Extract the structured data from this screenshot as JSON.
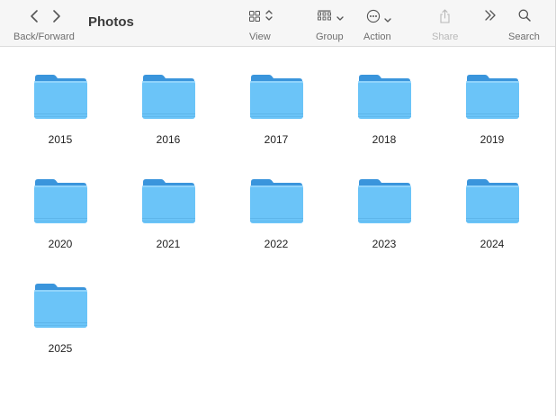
{
  "toolbar": {
    "nav_label": "Back/Forward",
    "title": "Photos",
    "view_label": "View",
    "group_label": "Group",
    "action_label": "Action",
    "share_label": "Share",
    "search_label": "Search"
  },
  "icons": {
    "back": "chevron-left-icon",
    "forward": "chevron-right-icon",
    "view": "icon-grid-icon",
    "group": "group-grid-icon",
    "action": "ellipsis-circle-icon",
    "share": "share-icon",
    "more": "double-chevron-right-icon",
    "search": "magnifier-icon"
  },
  "colors": {
    "folder_body": "#6bc4f8",
    "folder_tab": "#3a95dc",
    "toolbar_bg": "#f6f6f6"
  },
  "folders": [
    {
      "name": "2015"
    },
    {
      "name": "2016"
    },
    {
      "name": "2017"
    },
    {
      "name": "2018"
    },
    {
      "name": "2019"
    },
    {
      "name": "2020"
    },
    {
      "name": "2021"
    },
    {
      "name": "2022"
    },
    {
      "name": "2023"
    },
    {
      "name": "2024"
    },
    {
      "name": "2025"
    }
  ]
}
